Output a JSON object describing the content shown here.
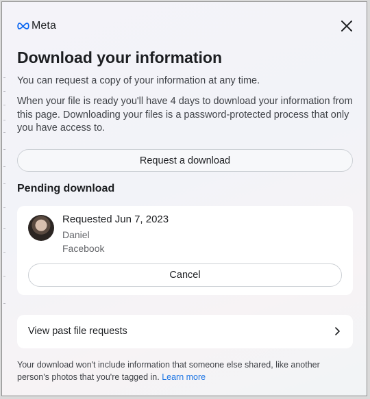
{
  "header": {
    "logo_text": "Meta",
    "close_icon": "close-icon"
  },
  "dialog": {
    "title": "Download your information",
    "intro": "You can request a copy of your information at any time.",
    "details": "When your file is ready you'll have 4 days to download your information from this page. Downloading your files is a password-protected process that only you have access to.",
    "request_button": "Request a download"
  },
  "pending": {
    "heading": "Pending download",
    "requested": "Requested Jun 7, 2023",
    "name": "Daniel",
    "app": "Facebook",
    "cancel_button": "Cancel"
  },
  "past_requests": {
    "label": "View past file requests",
    "icon": "chevron-right-icon"
  },
  "footer": {
    "text": "Your download won't include information that someone else shared, like another person's photos that you're tagged in.",
    "link": "Learn more"
  },
  "colors": {
    "link": "#1b74e4",
    "text_primary": "#1c1e21",
    "text_secondary": "#65676b"
  }
}
